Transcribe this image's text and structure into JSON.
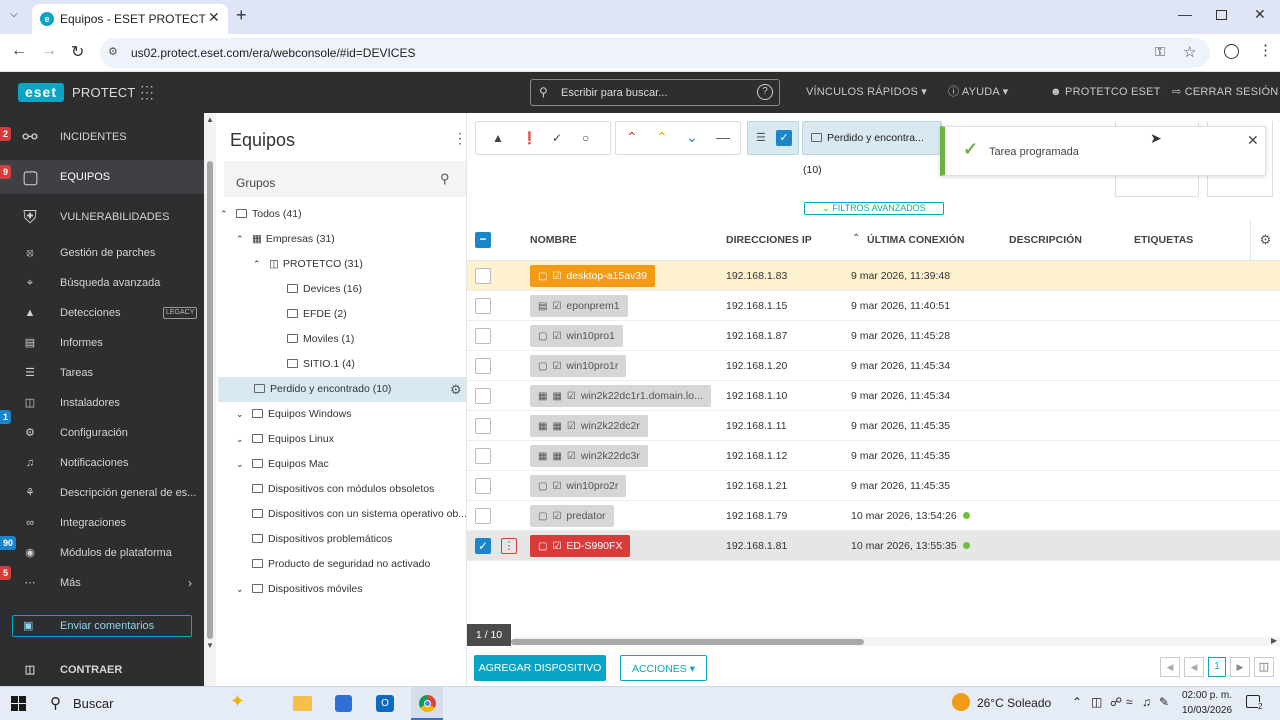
{
  "browser": {
    "tab_title": "Equipos - ESET PROTECT",
    "url": "us02.protect.eset.com/era/webconsole/#id=DEVICES"
  },
  "header": {
    "logo_text": "eset",
    "product": "PROTECT",
    "search_placeholder": "Escribir para buscar...",
    "quick_links": "VÍNCULOS RÁPIDOS",
    "help": "AYUDA",
    "user": "PROTETCO ESET",
    "logout": "CERRAR SESIÓN"
  },
  "sidebar": {
    "items": [
      {
        "label": "INCIDENTES",
        "badge": "2"
      },
      {
        "label": "EQUIPOS",
        "badge": "9"
      },
      {
        "label": "VULNERABILIDADES",
        "badge": ""
      },
      {
        "label": "Gestión de parches",
        "badge": ""
      },
      {
        "label": "Búsqueda avanzada",
        "badge": ""
      },
      {
        "label": "Detecciones",
        "badge": "",
        "tag": "LEGACY"
      },
      {
        "label": "Informes",
        "badge": ""
      },
      {
        "label": "Tareas",
        "badge": ""
      },
      {
        "label": "Instaladores",
        "badge": ""
      },
      {
        "label": "Configuración",
        "badge": "1"
      },
      {
        "label": "Notificaciones",
        "badge": ""
      },
      {
        "label": "Descripción general de es...",
        "badge": ""
      },
      {
        "label": "Integraciones",
        "badge": ""
      },
      {
        "label": "Módulos de plataforma",
        "badge": "90"
      },
      {
        "label": "Más",
        "badge": "5"
      }
    ],
    "feedback": "Enviar comentarios",
    "collapse": "CONTRAER"
  },
  "groups": {
    "title": "Equipos",
    "search_label": "Grupos",
    "tree": [
      {
        "label": "Todos (41)"
      },
      {
        "label": "Empresas (31)"
      },
      {
        "label": "PROTETCO (31)"
      },
      {
        "label": "Devices (16)"
      },
      {
        "label": "EFDE (2)"
      },
      {
        "label": "Moviles (1)"
      },
      {
        "label": "SITIO.1 (4)"
      },
      {
        "label": "Perdido y encontrado (10)"
      },
      {
        "label": "Equipos Windows"
      },
      {
        "label": "Equipos Linux"
      },
      {
        "label": "Equipos Mac"
      },
      {
        "label": "Dispositivos con módulos obsoletos"
      },
      {
        "label": "Dispositivos con un sistema operativo ob..."
      },
      {
        "label": "Dispositivos problemáticos"
      },
      {
        "label": "Producto de seguridad no activado"
      },
      {
        "label": "Dispositivos móviles"
      }
    ]
  },
  "filters": {
    "group_chip": "Perdido y encontra...(10)",
    "advanced": "FILTROS AVANZADOS"
  },
  "toast": {
    "text": "Tarea programada"
  },
  "table": {
    "headers": {
      "name": "NOMBRE",
      "ip": "DIRECCIONES IP",
      "last": "ÚLTIMA CONEXIÓN",
      "desc": "DESCRIPCIÓN",
      "tags": "ETIQUETAS"
    },
    "rows": [
      {
        "name": "desktop-a15av39",
        "ip": "192.168.1.83",
        "last": "9 mar 2026, 11:39:48"
      },
      {
        "name": "eponprem1",
        "ip": "192.168.1.15",
        "last": "9 mar 2026, 11:40:51"
      },
      {
        "name": "win10pro1",
        "ip": "192.168.1.87",
        "last": "9 mar 2026, 11:45:28"
      },
      {
        "name": "win10pro1r",
        "ip": "192.168.1.20",
        "last": "9 mar 2026, 11:45:34"
      },
      {
        "name": "win2k22dc1r1.domain.lo...",
        "ip": "192.168.1.10",
        "last": "9 mar 2026, 11:45:34"
      },
      {
        "name": "win2k22dc2r",
        "ip": "192.168.1.11",
        "last": "9 mar 2026, 11:45:35"
      },
      {
        "name": "win2k22dc3r",
        "ip": "192.168.1.12",
        "last": "9 mar 2026, 11:45:35"
      },
      {
        "name": "win10pro2r",
        "ip": "192.168.1.21",
        "last": "9 mar 2026, 11:45:35"
      },
      {
        "name": "predator",
        "ip": "192.168.1.79",
        "last": "10 mar 2026, 13:54:26"
      },
      {
        "name": "ED-S990FX",
        "ip": "192.168.1.81",
        "last": "10 mar 2026, 13:55:35"
      }
    ],
    "paging": "1 / 10",
    "page": "1"
  },
  "footer": {
    "add": "AGREGAR DISPOSITIVO",
    "actions": "ACCIONES"
  },
  "taskbar": {
    "search": "Buscar",
    "weather": "26°C  Soleado",
    "time": "02:00 p. m.",
    "date": "10/03/2026",
    "notifications": "2"
  },
  "colors": {
    "accent": "#0aa5c4",
    "warning_row": "#fdf1cf",
    "selected_row": "#e6e6e6",
    "danger": "#d93b3b",
    "orange": "#f39a16",
    "toast_green": "#6db33f"
  }
}
